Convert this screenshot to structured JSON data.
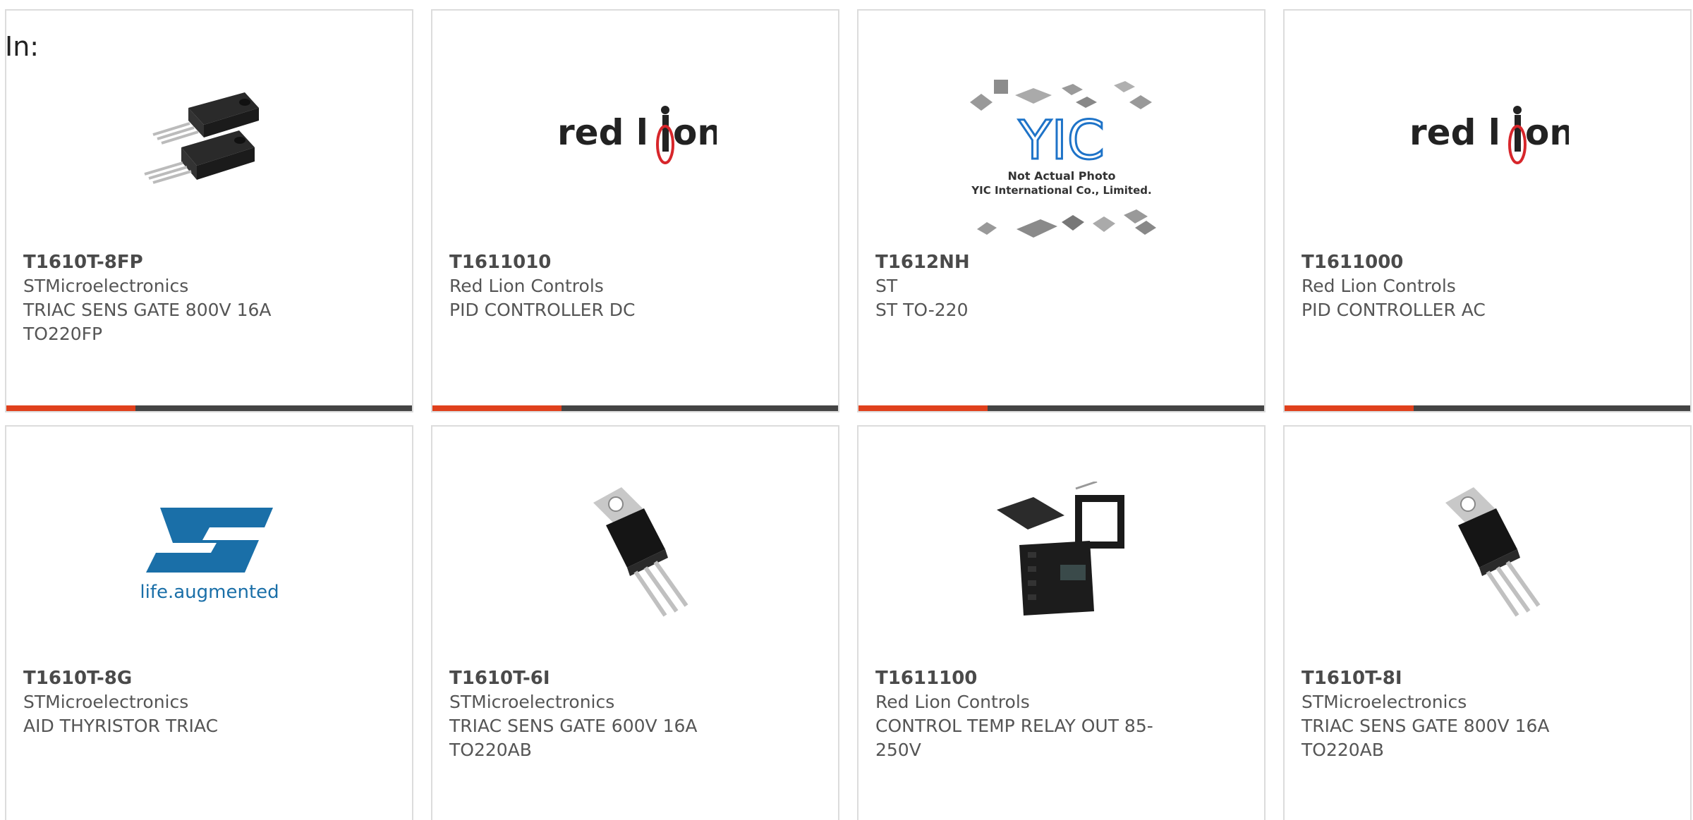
{
  "filter_label": "In:",
  "products": [
    {
      "part_number": "T1610T-8FP",
      "manufacturer": "STMicroelectronics",
      "description": "TRIAC SENS GATE 800V 16A",
      "description2": "TO220FP",
      "image": "to220fp-package-icon"
    },
    {
      "part_number": "T1611010",
      "manufacturer": "Red Lion Controls",
      "description": "PID CONTROLLER DC",
      "description2": "",
      "image": "red-lion-logo"
    },
    {
      "part_number": "T1612NH",
      "manufacturer": "ST",
      "description": "ST TO-220",
      "description2": "",
      "image": "yic-placeholder",
      "image_text": {
        "brand": "YIC",
        "line1": "Not Actual Photo",
        "line2": "YIC International Co., Limited."
      }
    },
    {
      "part_number": "T1611000",
      "manufacturer": "Red Lion Controls",
      "description": "PID CONTROLLER AC",
      "description2": "",
      "image": "red-lion-logo"
    },
    {
      "part_number": "T1610T-8G",
      "manufacturer": "STMicroelectronics",
      "description": "AID THYRISTOR TRIAC",
      "description2": "",
      "image": "st-logo",
      "image_text": {
        "tagline": "life.augmented"
      }
    },
    {
      "part_number": "T1610T-6I",
      "manufacturer": "STMicroelectronics",
      "description": "TRIAC SENS GATE 600V 16A",
      "description2": "TO220AB",
      "image": "to220ab-package-icon"
    },
    {
      "part_number": "T1611100",
      "manufacturer": "Red Lion Controls",
      "description": "CONTROL TEMP RELAY OUT 85-",
      "description2": "250V",
      "image": "temp-controller-photo"
    },
    {
      "part_number": "T1610T-8I",
      "manufacturer": "STMicroelectronics",
      "description": "TRIAC SENS GATE 800V 16A",
      "description2": "TO220AB",
      "image": "to220ab-package-icon"
    }
  ],
  "logos": {
    "red_lion_a": "red l",
    "red_lion_b": "on"
  },
  "colors": {
    "accent": "#e0401c",
    "bar": "#444444",
    "text": "#555555",
    "border": "#dcdcdc",
    "red_lion_red": "#d7262b",
    "st_blue": "#1a6fa8",
    "yic_blue": "#1e73c8"
  }
}
